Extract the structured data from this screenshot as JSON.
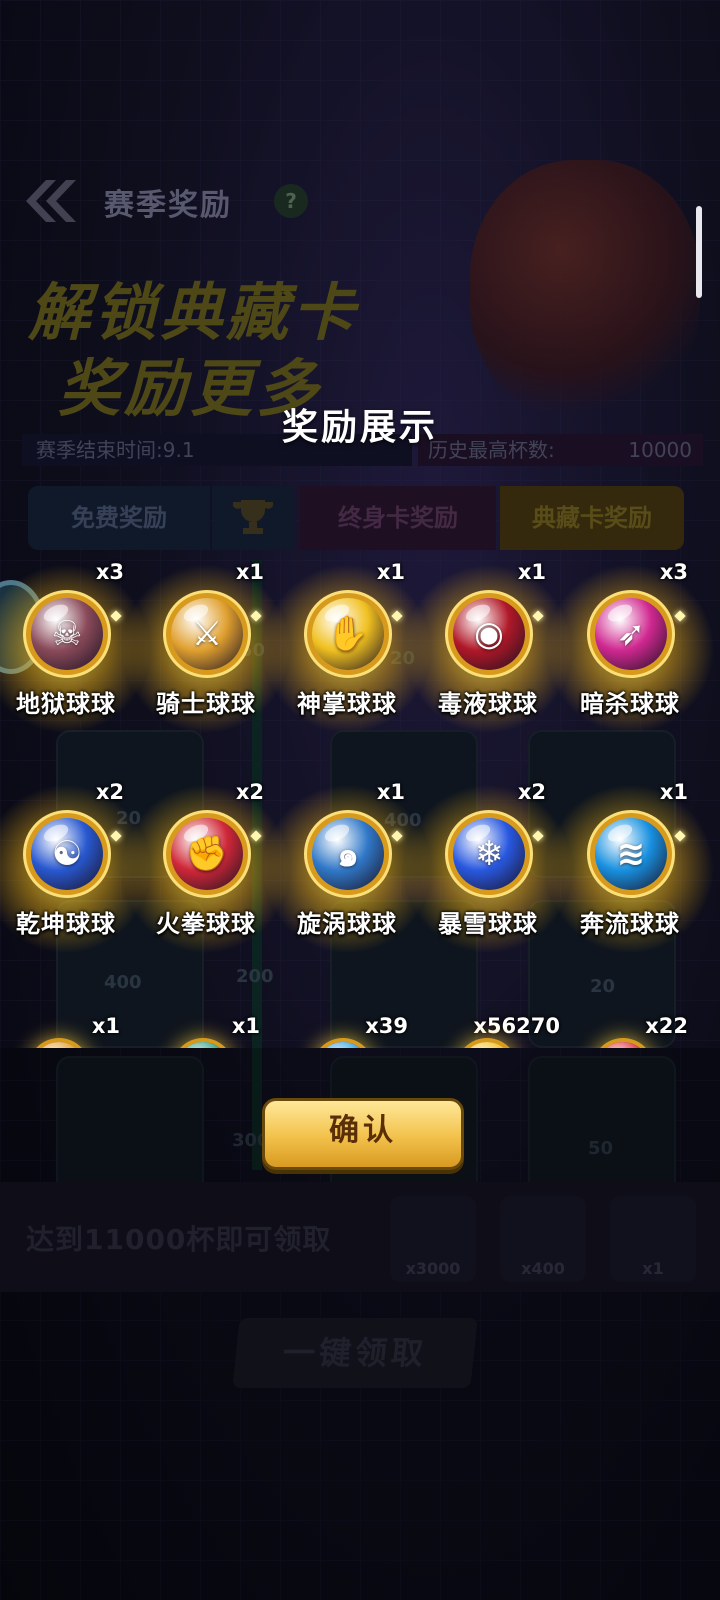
{
  "background": {
    "page_title": "赛季奖励",
    "help_label": "?",
    "headline_line1": "解锁典藏卡",
    "headline_line2": "奖励更多",
    "season_end": "赛季结束时间:9.1",
    "history_label": "历史最高杯数:",
    "history_value": "10000",
    "tabs": [
      "免费奖励",
      "终身卡奖励",
      "典藏卡奖励"
    ],
    "track_numbers": [
      "50",
      "20",
      "20",
      "400",
      "200",
      "400",
      "20",
      "50",
      "300"
    ],
    "reach_text": "达到11000杯即可领取",
    "mini_rewards": [
      "x3000",
      "x400",
      "x1"
    ],
    "claim_all": "一键领取"
  },
  "modal": {
    "title": "奖励展示",
    "confirm_label": "确认",
    "rewards": [
      {
        "name": "地狱球球",
        "count": "x3",
        "icon": "skull-icon",
        "color": "#8a4a5a",
        "glyph": "☠"
      },
      {
        "name": "骑士球球",
        "count": "x1",
        "icon": "knight-helmet-icon",
        "color": "#e0a030",
        "glyph": "⚔"
      },
      {
        "name": "神掌球球",
        "count": "x1",
        "icon": "palm-icon",
        "color": "#f0c020",
        "glyph": "✋"
      },
      {
        "name": "毒液球球",
        "count": "x1",
        "icon": "venom-icon",
        "color": "#b01828",
        "glyph": "◉"
      },
      {
        "name": "暗杀球球",
        "count": "x3",
        "icon": "blade-icon",
        "color": "#d02890",
        "glyph": "➶"
      },
      {
        "name": "乾坤球球",
        "count": "x2",
        "icon": "yin-yang-icon",
        "color": "#2858d0",
        "glyph": "☯"
      },
      {
        "name": "火拳球球",
        "count": "x2",
        "icon": "fist-icon",
        "color": "#d02838",
        "glyph": "✊"
      },
      {
        "name": "旋涡球球",
        "count": "x1",
        "icon": "vortex-icon",
        "color": "#3078c8",
        "glyph": "๑"
      },
      {
        "name": "暴雪球球",
        "count": "x2",
        "icon": "snowflake-icon",
        "color": "#2858e0",
        "glyph": "❄"
      },
      {
        "name": "奔流球球",
        "count": "x1",
        "icon": "wave-icon",
        "color": "#1890e0",
        "glyph": "≋"
      }
    ],
    "partial_row": [
      {
        "count": "x1",
        "icon": "ball-icon",
        "color": "#e0a030"
      },
      {
        "count": "x1",
        "icon": "ball-icon",
        "color": "#30a080"
      },
      {
        "count": "x39",
        "icon": "ball-icon",
        "color": "#30a0e0"
      },
      {
        "count": "x56270",
        "icon": "coin-icon",
        "color": "#f0c020"
      },
      {
        "count": "x22",
        "icon": "ball-icon",
        "color": "#e03040"
      }
    ]
  }
}
